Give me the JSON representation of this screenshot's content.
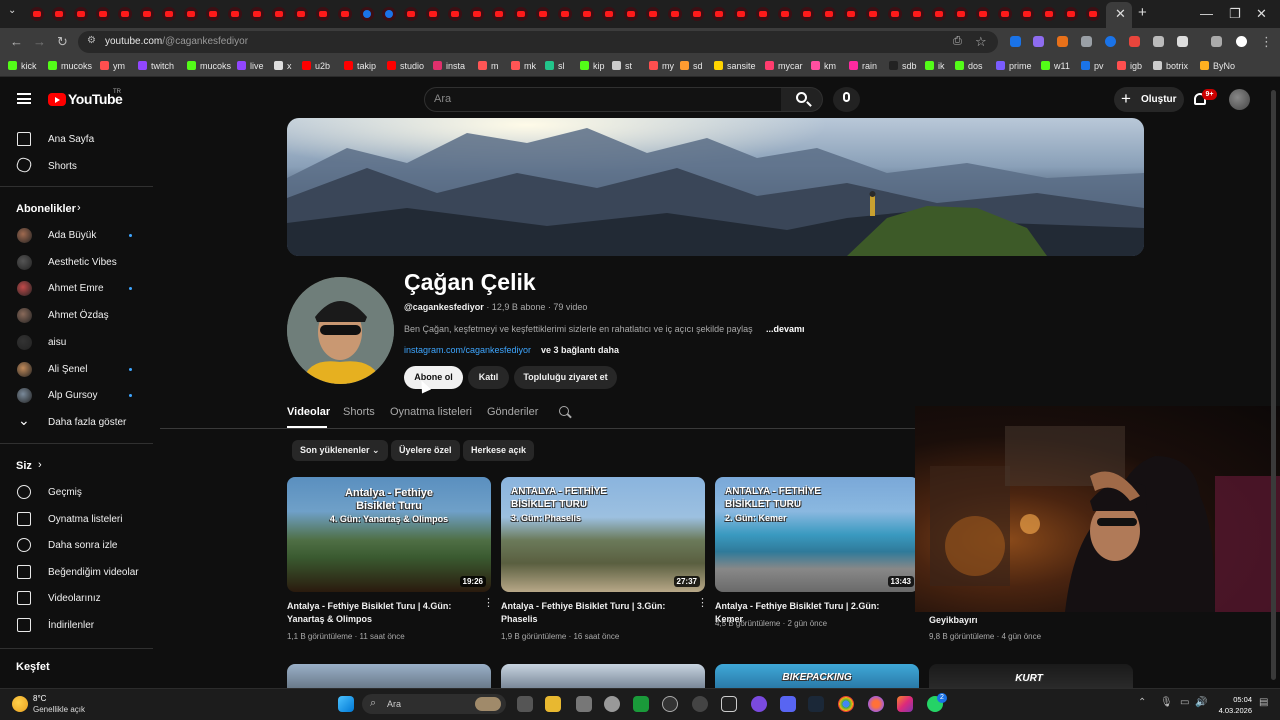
{
  "browser": {
    "url_host": "youtube.com",
    "url_path": "/@cagankesfediyor",
    "bookmarks": [
      "kick",
      "mucoks",
      "ym",
      "twitch",
      "mucoks",
      "live",
      "x",
      "u2b",
      "takip",
      "studio",
      "insta",
      "m",
      "mk",
      "sl",
      "kip",
      "st",
      "my",
      "sd",
      "sansite",
      "mycar",
      "km",
      "rain",
      "sdb",
      "ik",
      "dos",
      "prime",
      "w11",
      "pv",
      "igb",
      "botrix",
      "ByNo"
    ]
  },
  "header": {
    "logo_text": "YouTube",
    "logo_tr": "TR",
    "search_placeholder": "Ara",
    "create_label": "Oluştur",
    "notifications_badge": "9+"
  },
  "sidebar": {
    "main_items": [
      "Ana Sayfa",
      "Shorts"
    ],
    "subscriptions_title": "Abonelikler",
    "subscriptions": [
      {
        "name": "Ada Büyük",
        "new": true
      },
      {
        "name": "Aesthetic Vibes",
        "new": false
      },
      {
        "name": "Ahmet Emre",
        "new": true
      },
      {
        "name": "Ahmet Özdaş",
        "new": false
      },
      {
        "name": "aisu",
        "new": false
      },
      {
        "name": "Ali Şenel",
        "new": true
      },
      {
        "name": "Alp Gursoy",
        "new": true
      }
    ],
    "show_more": "Daha fazla göster",
    "you_title": "Siz",
    "you_items": [
      "Geçmiş",
      "Oynatma listeleri",
      "Daha sonra izle",
      "Beğendiğim videolar",
      "Videolarınız",
      "İndirilenler"
    ],
    "explore_title": "Keşfet"
  },
  "channel": {
    "name": "Çağan Çelik",
    "handle": "@cagankesfediyor",
    "stats": " · 12,9 B abone · 79 video",
    "description": "Ben Çağan, keşfetmeyi ve keşfettiklerimi sizlerle en rahatlatıcı ve iç açıcı şekilde paylaş",
    "more": "...devamı",
    "link": "instagram.com/cagankesfediyor",
    "link_more": "ve 3 bağlantı daha",
    "subscribe_label": "Abone ol",
    "join_label": "Katıl",
    "community_label": "Topluluğu ziyaret et"
  },
  "tabs": [
    "Videolar",
    "Shorts",
    "Oynatma listeleri",
    "Gönderiler"
  ],
  "chips": [
    "Son yüklenenler",
    "Üyelere özel",
    "Herkese açık"
  ],
  "videos": [
    {
      "thumb_text": [
        "Antalya - Fethiye",
        "Bisiklet Turu",
        "4. Gün: Yanartaş & Olimpos"
      ],
      "duration": "19:26",
      "title": "Antalya - Fethiye Bisiklet Turu | 4.Gün: Yanartaş & Olimpos",
      "meta": "1,1 B görüntüleme · 11 saat önce"
    },
    {
      "thumb_text": [
        "ANTALYA - FETHİYE",
        "BİSİKLET TURU",
        "3. Gün: Phaselis"
      ],
      "duration": "27:37",
      "title": "Antalya - Fethiye Bisiklet Turu | 3.Gün: Phaselis",
      "meta": "1,9 B görüntüleme · 16 saat önce"
    },
    {
      "thumb_text": [
        "ANTALYA - FETHİYE",
        "BİSİKLET TURU",
        "2. Gün: Kemer"
      ],
      "duration": "13:43",
      "title": "Antalya - Fethiye Bisiklet Turu | 2.Gün: Kemer",
      "meta": "4,5 B görüntüleme · 2 gün önce"
    },
    {
      "thumb_text": [],
      "duration": "",
      "title": "Geyikbayırı",
      "meta": "9,8 B görüntüleme · 4 gün önce"
    }
  ],
  "second_row": {
    "thumb3_text": "BIKEPACKING",
    "thumb4_text": "KURT"
  },
  "taskbar": {
    "weather_temp": "8°C",
    "weather_desc": "Genellikle açık",
    "search_label": "Ara",
    "time": "05:04",
    "date": "4.03.2026",
    "whatsapp_badge": "2"
  }
}
